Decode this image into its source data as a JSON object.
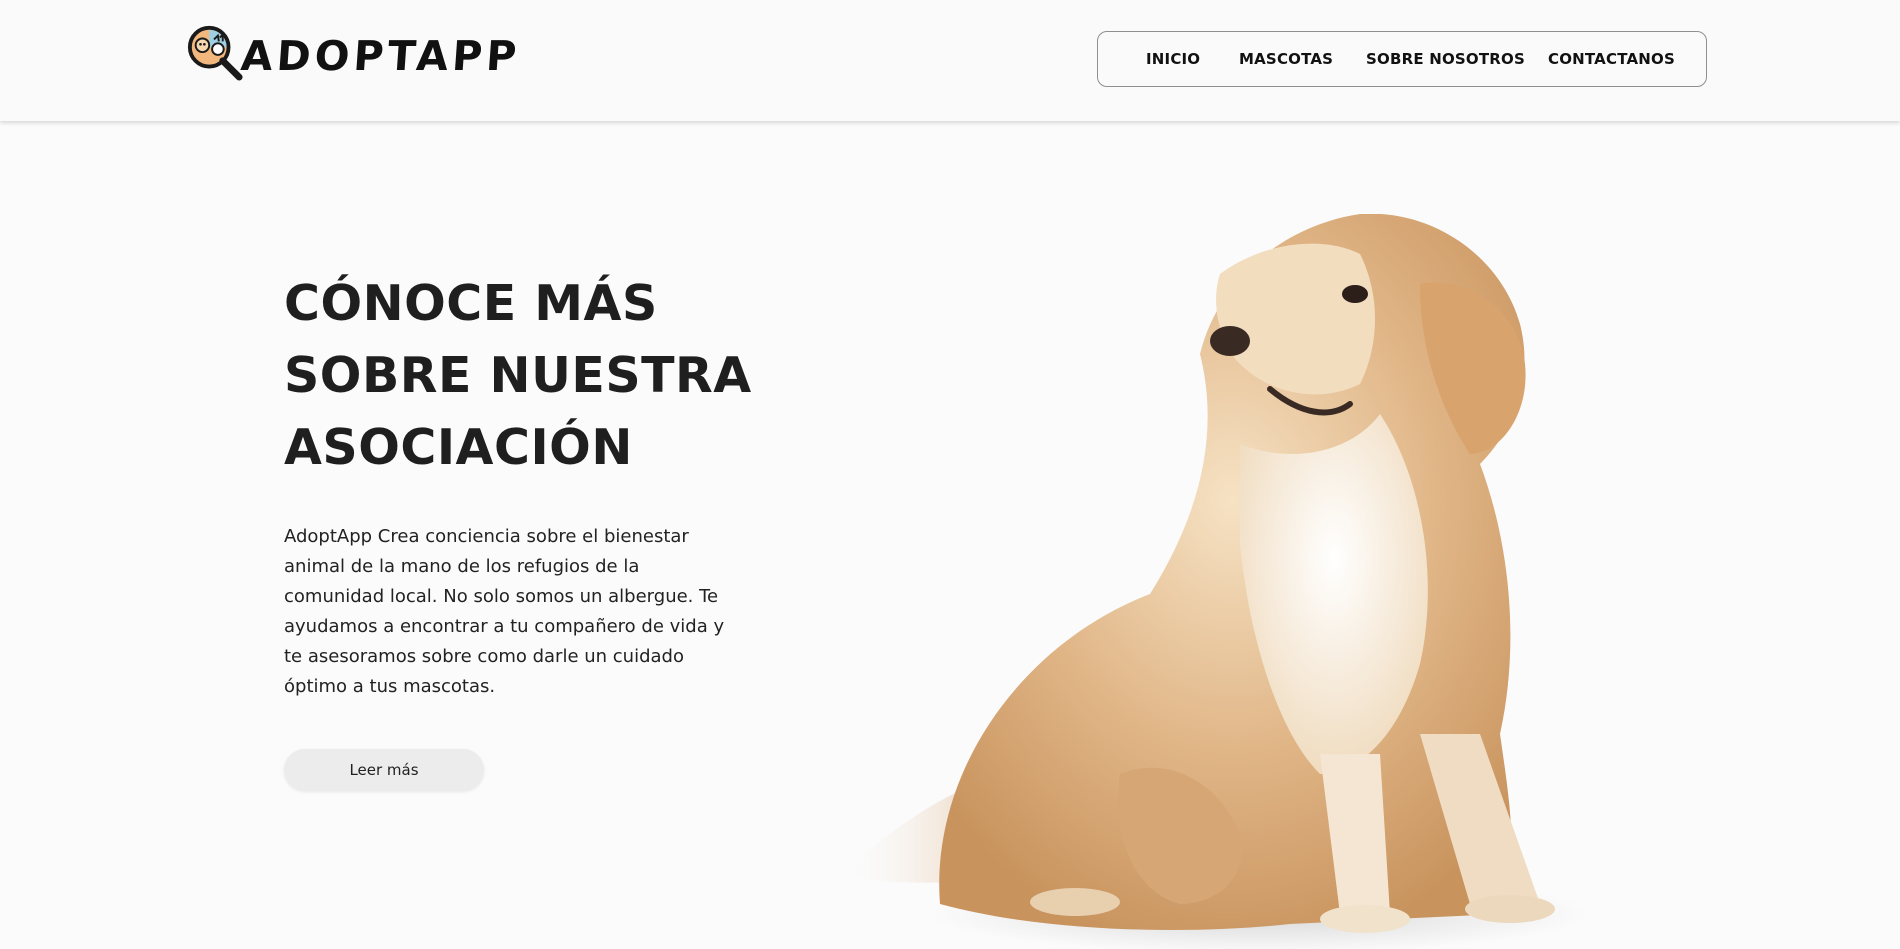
{
  "brand": {
    "name": "ADOPTAPP",
    "logo_icon": "magnifier-pets-icon"
  },
  "nav": {
    "items": [
      {
        "label": "INICIO"
      },
      {
        "label": "MASCOTAS"
      },
      {
        "label": "SOBRE NOSOTROS"
      },
      {
        "label": "CONTACTANOS"
      }
    ]
  },
  "hero": {
    "title_lines": [
      "CÓNOCE MÁS",
      "SOBRE NUESTRA",
      "ASOCIACIÓN"
    ],
    "text_lines": [
      "AdoptApp Crea conciencia sobre el bienestar",
      "animal de la mano de los refugios de la",
      "comunidad local. No solo somos un albergue. Te",
      "ayudamos a encontrar a tu compañero de vida y",
      "te asesoramos sobre como darle un cuidado",
      "óptimo a tus mascotas."
    ],
    "button_label": "Leer más",
    "image": "golden-retriever-sitting"
  },
  "colors": {
    "background": "#fbfbfb",
    "text": "#1f1f1f",
    "button": "#ececec",
    "nav_border": "#8f8f8f"
  }
}
